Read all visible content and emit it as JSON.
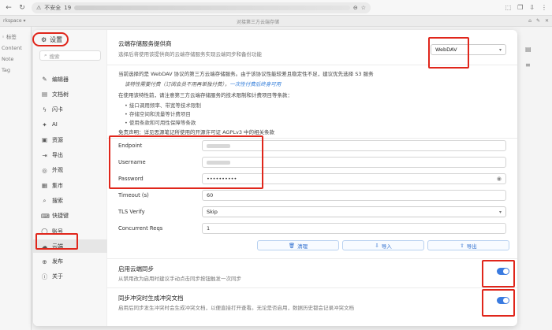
{
  "browser": {
    "security_label": "不安全",
    "url_prefix": "19",
    "icons": [
      "back-arrow-icon",
      "forward-arrow-icon",
      "reload-icon",
      "lock-warning-icon",
      "key-icon",
      "zoom-icon",
      "star-icon",
      "extension-icon",
      "copy-icon",
      "download-icon",
      "menu-icon"
    ]
  },
  "tab_strip": {
    "left": "rkspace ▾",
    "center_title": "对接第三方云端存储",
    "right": [
      "⌂",
      "✎",
      "✕"
    ]
  },
  "bg_sidebar": {
    "items": [
      "◦ 标签",
      "Content",
      "Note",
      "Tag"
    ]
  },
  "settings": {
    "title": "设置",
    "search_placeholder": "搜索",
    "nav": [
      {
        "icon": "✎",
        "label": "编辑器"
      },
      {
        "icon": "▤",
        "label": "文档树"
      },
      {
        "icon": "ϟ",
        "label": "闪卡"
      },
      {
        "icon": "✦",
        "label": "AI"
      },
      {
        "icon": "▣",
        "label": "资源"
      },
      {
        "icon": "⇥",
        "label": "导出"
      },
      {
        "icon": "◎",
        "label": "外观"
      },
      {
        "icon": "▦",
        "label": "集市"
      },
      {
        "icon": "⌕",
        "label": "搜索"
      },
      {
        "icon": "⌨",
        "label": "快捷键"
      },
      {
        "icon": "◯",
        "label": "账号"
      },
      {
        "icon": "☁",
        "label": "云端"
      },
      {
        "icon": "⊕",
        "label": "发布"
      },
      {
        "icon": "ⓘ",
        "label": "关于"
      }
    ],
    "active_index": 11
  },
  "cloud": {
    "provider_title": "云端存储服务提供商",
    "provider_desc": "选择后将使用该提供商的云端存储服务实现云端同步和备份功能",
    "provider_value": "WebDAV",
    "info_line1": "当前选择的是 WebDAV 协议的第三方云端存储服务。由于该协议性能较差且稳定性不足，建议优先选择 S3 服务",
    "info_italic_a": "该特性需要付费（订阅会员不用再单独付费），",
    "info_italic_link": "一次性付费后终身可用",
    "info_line3": "在使用该特性前，请注意第三方云端存储服务的技术限制和计费项目等条款：",
    "bullets": [
      "接口调用频率、带宽等技术限制",
      "存储空间和流量等计费项目",
      "使用条款和可用性保障等条款"
    ],
    "disclaimer": "免责声明：详见思源笔记所使用的开源许可证 AGPLv3 中的相关条款",
    "fields": [
      {
        "label": "Endpoint",
        "value": ""
      },
      {
        "label": "Username",
        "value": ""
      },
      {
        "label": "Password",
        "value": "••••••••••"
      },
      {
        "label": "Timeout (s)",
        "value": "60"
      },
      {
        "label": "TLS Verify",
        "value": "Skip"
      },
      {
        "label": "Concurrent Reqs",
        "value": "1"
      }
    ],
    "buttons": [
      {
        "icon": "🗑",
        "label": "清理"
      },
      {
        "icon": "⇩",
        "label": "导入"
      },
      {
        "icon": "⇧",
        "label": "导出"
      }
    ],
    "sync_title": "启用云端同步",
    "sync_desc": "从禁用改为启用时建议手动点击同步按钮触发一次同步",
    "conflict_title": "同步冲突时生成冲突文档",
    "conflict_desc": "启用后同步发生冲突时会生成冲突文档，以便直接打开查看。无论是否启用，数据历史都会记录冲突文档"
  },
  "colors": {
    "accent": "#3a7be0",
    "highlight": "#e0261b"
  }
}
